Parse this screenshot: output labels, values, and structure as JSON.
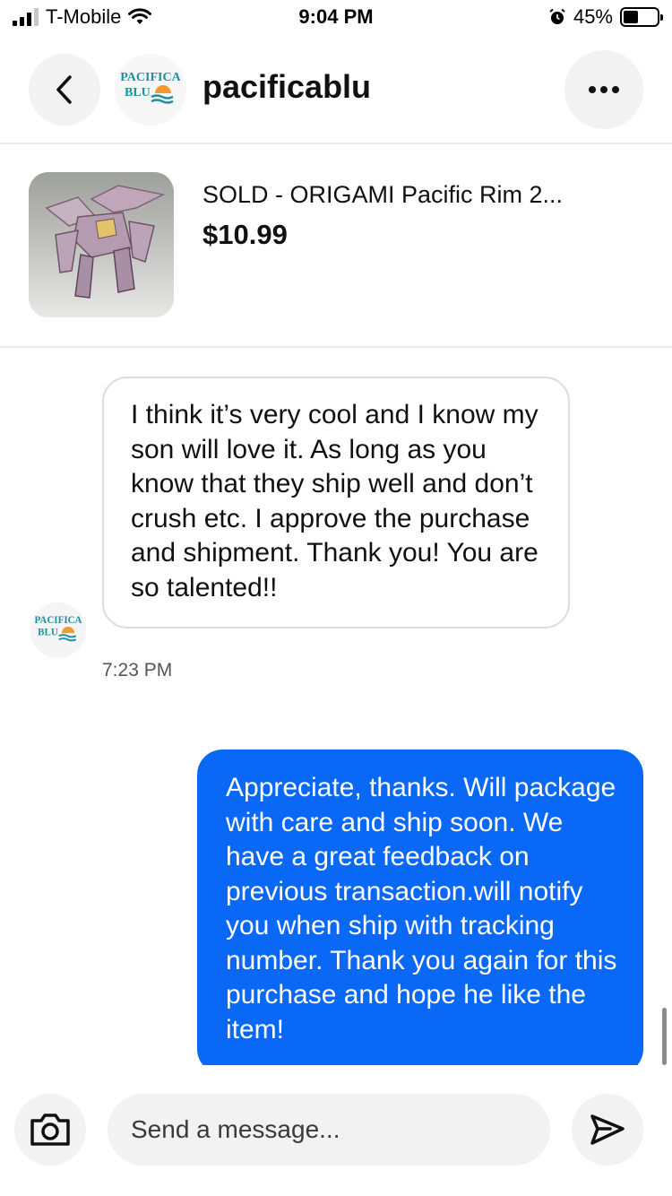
{
  "status_bar": {
    "carrier": "T-Mobile",
    "time": "9:04 PM",
    "battery": "45%",
    "battery_level": 0.45
  },
  "header": {
    "seller_name": "pacificablu",
    "avatar_text_line1": "PACIFICA",
    "avatar_text_line2": "BLU"
  },
  "item": {
    "title": "SOLD - ORIGAMI Pacific Rim 2...",
    "price": "$10.99"
  },
  "messages": [
    {
      "direction": "incoming",
      "text": "I think it’s very cool and I know my son will love it. As long as you know that they ship well and don’t crush etc. I approve the purchase and shipment. Thank you! You are so talented!!",
      "time": "7:23 PM"
    },
    {
      "direction": "outgoing",
      "text": "Appreciate, thanks. Will package with care and ship soon. We have a great feedback on previous transaction.will notify you when ship with tracking number. Thank you again for this purchase and hope he like the item!"
    }
  ],
  "composer": {
    "placeholder": "Send a message..."
  },
  "colors": {
    "outgoing_bubble": "#0968f6",
    "brand_teal": "#1e8fa0",
    "brand_orange": "#f29a2e"
  },
  "icons": {
    "back": "chevron-left-icon",
    "more": "more-horizontal-icon",
    "camera": "camera-icon",
    "send": "send-icon"
  }
}
